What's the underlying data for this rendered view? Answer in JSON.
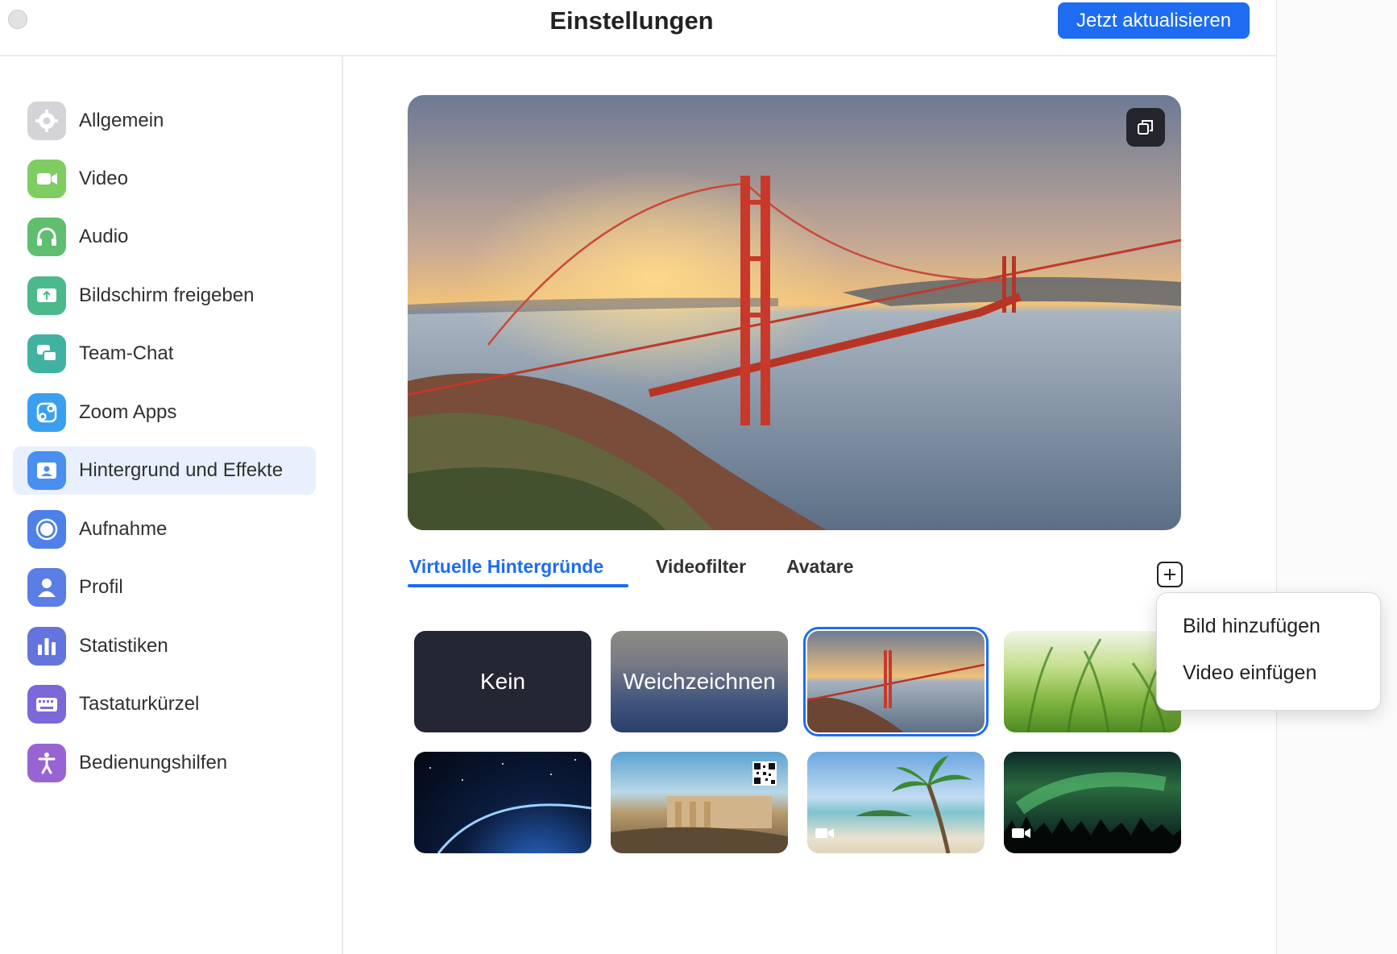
{
  "window": {
    "title": "Einstellungen",
    "update_button": "Jetzt aktualisieren"
  },
  "sidebar": {
    "items": [
      {
        "label": "Allgemein",
        "icon": "gear-icon",
        "color": "#d2d2d6"
      },
      {
        "label": "Video",
        "icon": "video-camera-icon",
        "color": "#7ecb5b"
      },
      {
        "label": "Audio",
        "icon": "headphones-icon",
        "color": "#5fbf6f"
      },
      {
        "label": "Bildschirm freigeben",
        "icon": "share-screen-icon",
        "color": "#48b98b"
      },
      {
        "label": "Team-Chat",
        "icon": "chat-bubbles-icon",
        "color": "#3fb2a0"
      },
      {
        "label": "Zoom Apps",
        "icon": "apps-icon",
        "color": "#3a9df0"
      },
      {
        "label": "Hintergrund und Effekte",
        "icon": "portrait-icon",
        "color": "#4a8ff0",
        "active": true
      },
      {
        "label": "Aufnahme",
        "icon": "record-icon",
        "color": "#4e80ec"
      },
      {
        "label": "Profil",
        "icon": "person-icon",
        "color": "#5a7ee6"
      },
      {
        "label": "Statistiken",
        "icon": "bar-chart-icon",
        "color": "#6375dc"
      },
      {
        "label": "Tastaturkürzel",
        "icon": "keyboard-icon",
        "color": "#7c68d8"
      },
      {
        "label": "Bedienungshilfen",
        "icon": "accessibility-icon",
        "color": "#9864d4"
      }
    ]
  },
  "main": {
    "preview_rotate_icon": "rotate-icon",
    "tabs": [
      {
        "label": "Virtuelle Hintergründe",
        "active": true
      },
      {
        "label": "Videofilter"
      },
      {
        "label": "Avatare"
      }
    ],
    "add_icon": "plus-icon",
    "backgrounds": [
      {
        "label": "Kein",
        "kind": "none"
      },
      {
        "label": "Weichzeichnen",
        "kind": "blur"
      },
      {
        "kind": "golden-gate",
        "selected": true
      },
      {
        "kind": "grass"
      },
      {
        "kind": "earth-space"
      },
      {
        "kind": "ruins",
        "badge": "qr-code-icon"
      },
      {
        "kind": "beach",
        "badge": "video-badge-icon"
      },
      {
        "kind": "aurora",
        "badge": "video-badge-icon"
      }
    ]
  },
  "add_menu": {
    "items": [
      "Bild hinzufügen",
      "Video einfügen"
    ]
  },
  "colors": {
    "accent": "#1d6cf2",
    "active_nav_bg": "#e8f0fd"
  }
}
